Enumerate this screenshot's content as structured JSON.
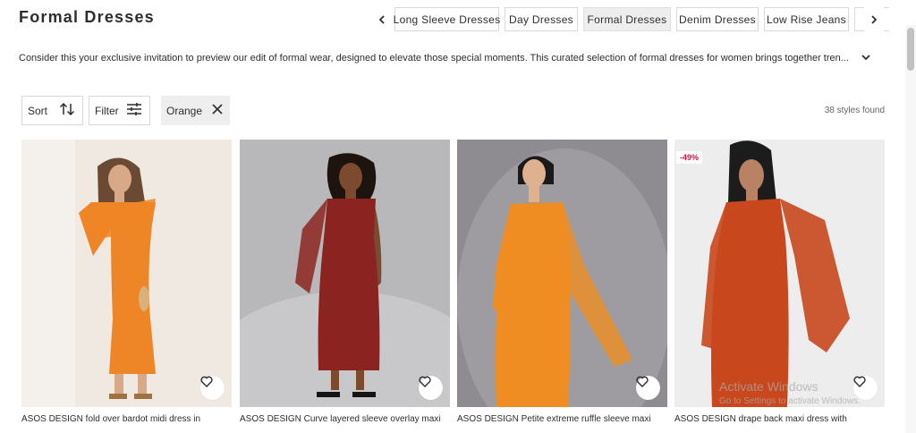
{
  "page": {
    "title": "Formal Dresses"
  },
  "category_chips": [
    {
      "label": "Long Sleeve Dresses",
      "active": false
    },
    {
      "label": "Day Dresses",
      "active": false
    },
    {
      "label": "Formal Dresses",
      "active": true
    },
    {
      "label": "Denim Dresses",
      "active": false
    },
    {
      "label": "Low Rise Jeans",
      "active": false
    },
    {
      "label": "",
      "active": false
    }
  ],
  "description": "Consider this your exclusive invitation to preview our edit of formal wear, designed to elevate those special moments. This curated selection of formal dresses for women brings together tren...",
  "controls": {
    "sort_label": "Sort",
    "filter_label": "Filter",
    "active_facet": "Orange",
    "styles_found": "38 styles found"
  },
  "products": [
    {
      "title": "ASOS DESIGN fold over bardot midi dress in",
      "badge": "",
      "dress_color": "#ee8526",
      "bg_color": "#efe9e2"
    },
    {
      "title": "ASOS DESIGN Curve layered sleeve overlay maxi",
      "badge": "",
      "dress_color": "#8b2420",
      "bg_color": "#b8b8bb"
    },
    {
      "title": "ASOS DESIGN Petite extreme ruffle sleeve maxi",
      "badge": "",
      "dress_color": "#ef8d22",
      "bg_color": "#8e8c90"
    },
    {
      "title": "ASOS DESIGN drape back maxi dress with",
      "badge": "-49%",
      "dress_color": "#c8471d",
      "bg_color": "#ededed"
    }
  ],
  "watermark": {
    "title": "Activate Windows",
    "subtitle": "Go to Settings to activate Windows."
  },
  "icons": {
    "prev": "chevron-left-icon",
    "next": "chevron-right-icon",
    "expand": "chevron-down-icon",
    "sort": "sort-arrows-icon",
    "filter": "sliders-icon",
    "remove": "close-icon",
    "save": "heart-icon"
  },
  "colors": {
    "text": "#2d2d2d",
    "sale": "#d01345",
    "active_chip": "#eeeeee"
  }
}
